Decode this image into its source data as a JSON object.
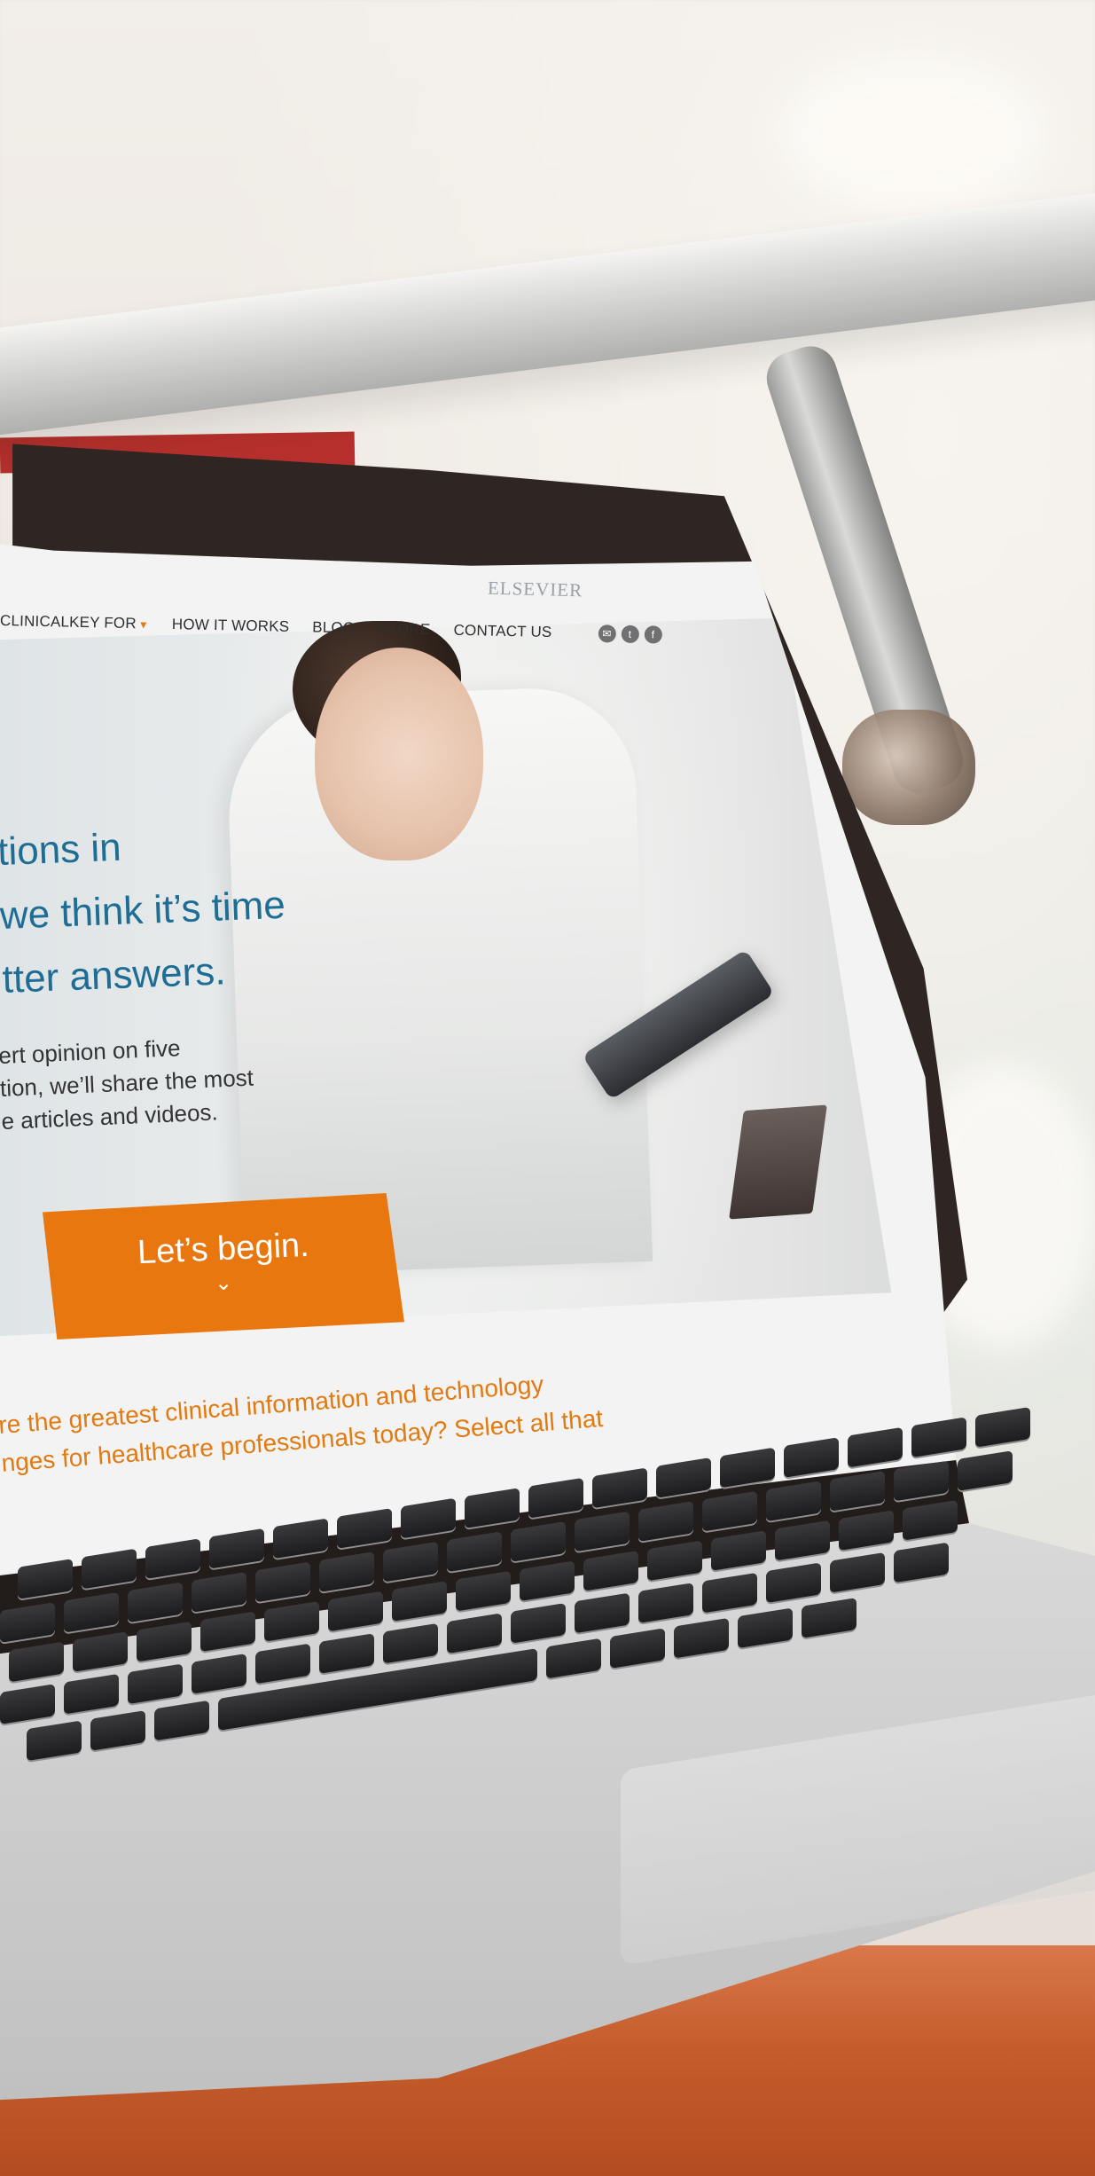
{
  "site": {
    "brand": "ELSEVIER",
    "nav": [
      {
        "label": "CLINICALKEY FOR",
        "has_dropdown": true
      },
      {
        "label": "HOW IT WORKS"
      },
      {
        "label": "BLOG"
      },
      {
        "label": "STORE"
      },
      {
        "label": "CONTACT US"
      }
    ],
    "social_icons": [
      "email-icon",
      "twitter-icon",
      "facebook-icon"
    ],
    "hero": {
      "headline": [
        "tions in",
        "we think it’s time",
        "tter answers."
      ],
      "lead": [
        "ert opinion on five",
        "tion, we’ll share the most",
        "e articles and videos."
      ],
      "cta_label": "Let’s begin.",
      "cta_icon": "chevron-down-icon"
    },
    "question": [
      "re the greatest clinical information and technology",
      "nges for healthcare professionals today? Select all that"
    ]
  },
  "colors": {
    "accent": "#e8770f",
    "headline": "#1e6d95",
    "nav_text": "#2f2f31"
  }
}
